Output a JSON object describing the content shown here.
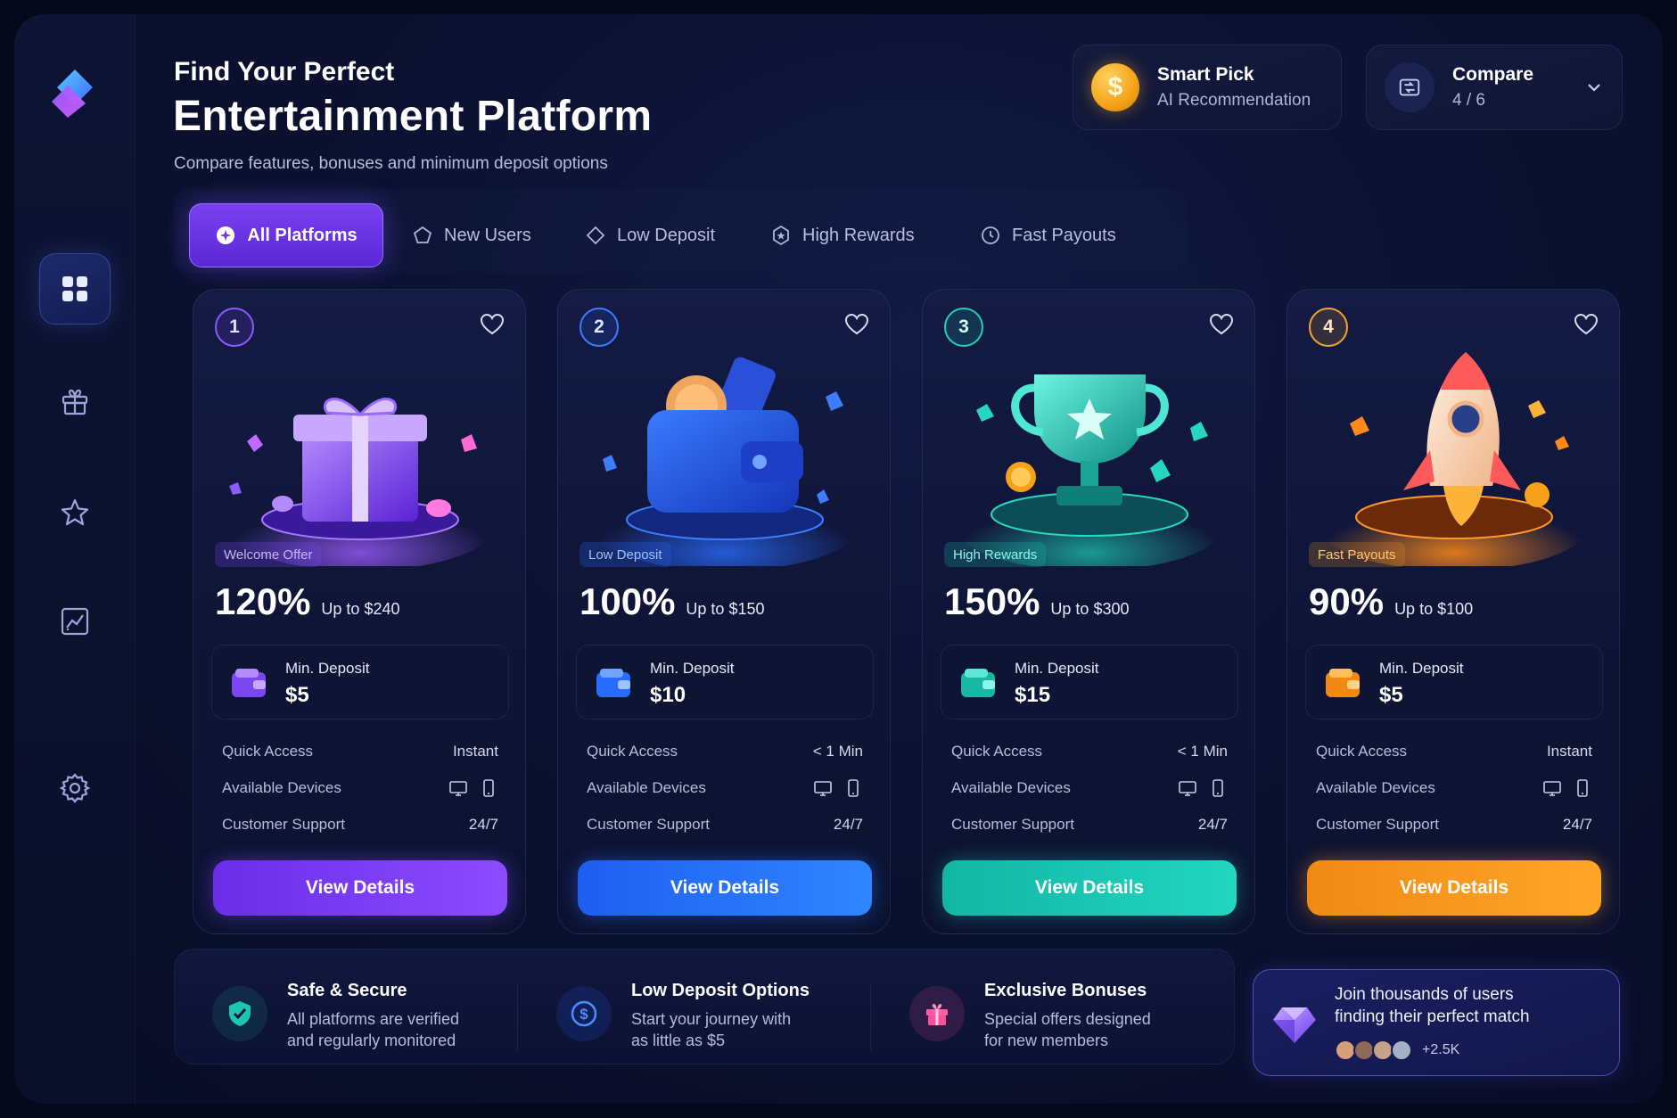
{
  "header": {
    "kicker": "Find Your Perfect",
    "title": "Entertainment Platform",
    "subtitle": "Compare features, bonuses and minimum deposit options"
  },
  "smart_pick": {
    "icon": "dollar-coin-icon",
    "title": "Smart Pick",
    "subtitle": "AI Recommendation"
  },
  "compare": {
    "icon": "compare-icon",
    "title": "Compare",
    "count": "4 / 6"
  },
  "sidebar": {
    "items": [
      {
        "icon": "dashboard-grid-icon",
        "active": true
      },
      {
        "icon": "gift-icon",
        "active": false
      },
      {
        "icon": "star-icon",
        "active": false
      },
      {
        "icon": "analytics-chart-icon",
        "active": false
      },
      {
        "icon": "settings-gear-icon",
        "active": false
      }
    ]
  },
  "tabs": [
    {
      "label": "All Platforms",
      "icon": "sparkle-icon",
      "active": true
    },
    {
      "label": "New Users",
      "icon": "pentagon-icon",
      "active": false
    },
    {
      "label": "Low Deposit",
      "icon": "diamond-icon",
      "active": false
    },
    {
      "label": "High Rewards",
      "icon": "badge-icon",
      "active": false
    },
    {
      "label": "Fast Payouts",
      "icon": "clock-icon",
      "active": false
    }
  ],
  "cards": [
    {
      "number": "1",
      "badge": "Welcome Offer",
      "bonus": "120%",
      "upto": "Up to $240",
      "deposit_label": "Min. Deposit",
      "deposit_value": "$5",
      "rows": [
        {
          "label": "Quick Access",
          "value": "Instant"
        },
        {
          "label": "Available Devices",
          "value": ""
        },
        {
          "label": "Customer Support",
          "value": "24/7"
        }
      ],
      "cta": "View Details",
      "art": "gift-box-illustration",
      "accent": "#8a4dff"
    },
    {
      "number": "2",
      "badge": "Low Deposit",
      "bonus": "100%",
      "upto": "Up to $150",
      "deposit_label": "Min. Deposit",
      "deposit_value": "$10",
      "rows": [
        {
          "label": "Quick Access",
          "value": "< 1 Min"
        },
        {
          "label": "Available Devices",
          "value": ""
        },
        {
          "label": "Customer Support",
          "value": "24/7"
        }
      ],
      "cta": "View Details",
      "art": "wallet-illustration",
      "accent": "#2a6bff"
    },
    {
      "number": "3",
      "badge": "High Rewards",
      "bonus": "150%",
      "upto": "Up to $300",
      "deposit_label": "Min. Deposit",
      "deposit_value": "$15",
      "rows": [
        {
          "label": "Quick Access",
          "value": "< 1 Min"
        },
        {
          "label": "Available Devices",
          "value": ""
        },
        {
          "label": "Customer Support",
          "value": "24/7"
        }
      ],
      "cta": "View Details",
      "art": "trophy-illustration",
      "accent": "#1fd0b8"
    },
    {
      "number": "4",
      "badge": "Fast Payouts",
      "bonus": "90%",
      "upto": "Up to $100",
      "deposit_label": "Min. Deposit",
      "deposit_value": "$5",
      "rows": [
        {
          "label": "Quick Access",
          "value": "Instant"
        },
        {
          "label": "Available Devices",
          "value": ""
        },
        {
          "label": "Customer Support",
          "value": "24/7"
        }
      ],
      "cta": "View Details",
      "art": "rocket-illustration",
      "accent": "#ff9a1a"
    }
  ],
  "features": [
    {
      "icon": "shield-check-icon",
      "title": "Safe & Secure",
      "line1": "All platforms are verified",
      "line2": "and regularly monitored"
    },
    {
      "icon": "dollar-circle-icon",
      "title": "Low Deposit Options",
      "line1": "Start your journey with",
      "line2": "as little as $5"
    },
    {
      "icon": "gift-icon",
      "title": "Exclusive Bonuses",
      "line1": "Special offers designed",
      "line2": "for new members"
    }
  ],
  "join": {
    "icon": "gem-icon",
    "line1": "Join thousands of users",
    "line2": "finding their perfect match",
    "count": "+2.5K"
  }
}
